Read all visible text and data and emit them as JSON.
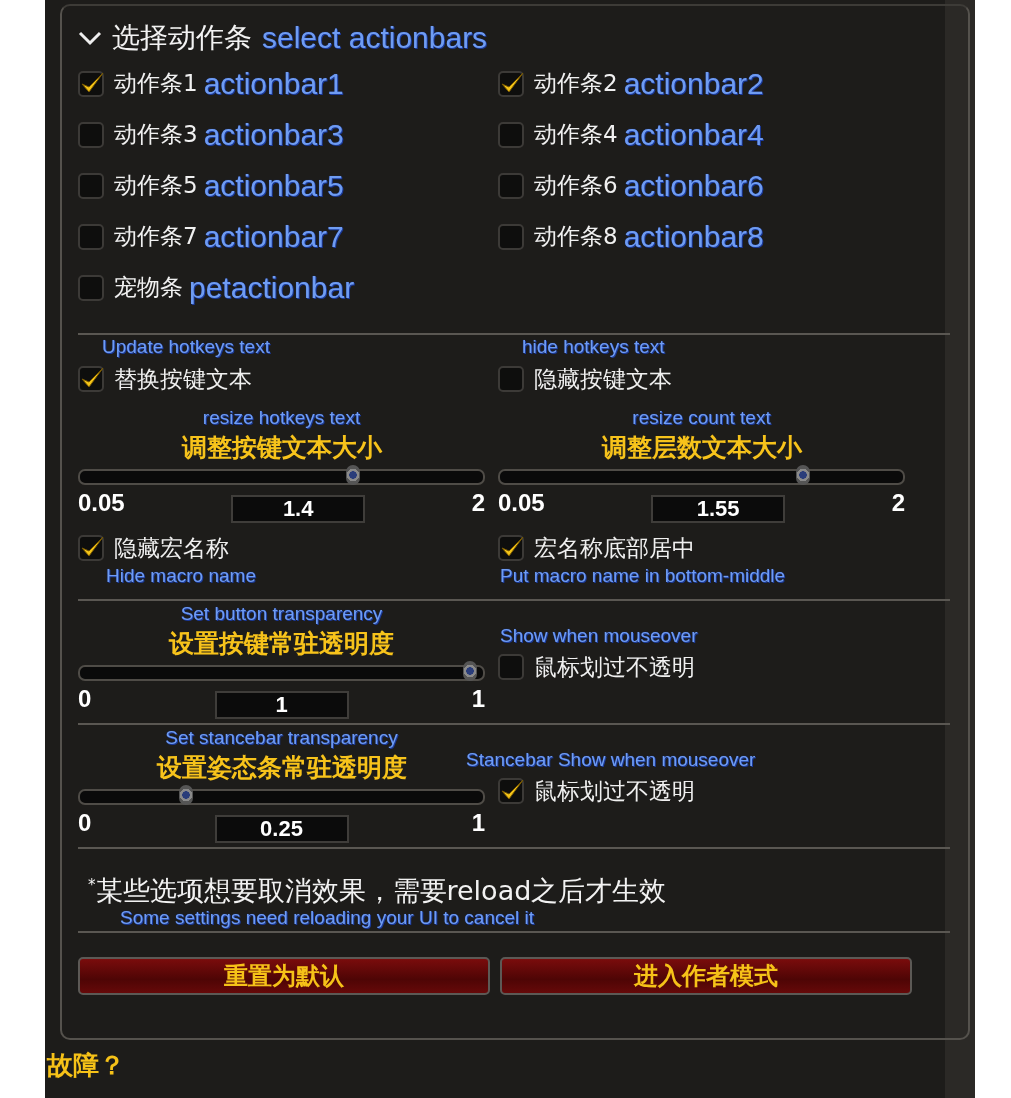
{
  "header": {
    "expanded": true,
    "title": "选择动作条",
    "annotation": "select actionbars"
  },
  "actionbars": [
    {
      "label": "动作条1",
      "annotation": "actionbar1",
      "checked": true
    },
    {
      "label": "动作条2",
      "annotation": "actionbar2",
      "checked": true
    },
    {
      "label": "动作条3",
      "annotation": "actionbar3",
      "checked": false
    },
    {
      "label": "动作条4",
      "annotation": "actionbar4",
      "checked": false
    },
    {
      "label": "动作条5",
      "annotation": "actionbar5",
      "checked": false
    },
    {
      "label": "动作条6",
      "annotation": "actionbar6",
      "checked": false
    },
    {
      "label": "动作条7",
      "annotation": "actionbar7",
      "checked": false
    },
    {
      "label": "动作条8",
      "annotation": "actionbar8",
      "checked": false
    },
    {
      "label": "宠物条",
      "annotation": "petactionbar",
      "checked": false
    }
  ],
  "hotkey_options": [
    {
      "annotation": "Update hotkeys text",
      "label": "替换按键文本",
      "checked": true
    },
    {
      "annotation": "hide hotkeys text",
      "label": "隐藏按键文本",
      "checked": false
    }
  ],
  "sliders": [
    {
      "annotation": "resize hotkeys text",
      "title": "调整按键文本大小",
      "min": "0.05",
      "max": "2",
      "value": "1.4",
      "level": 0.69
    },
    {
      "annotation": "resize count text",
      "title": "调整层数文本大小",
      "min": "0.05",
      "max": "2",
      "value": "1.55",
      "level": 0.77
    }
  ],
  "macro_options": [
    {
      "label": "隐藏宏名称",
      "annotation": "Hide macro name",
      "checked": true
    },
    {
      "label": "宏名称底部居中",
      "annotation": "Put macro name in bottom-middle",
      "checked": true
    }
  ],
  "transparency": [
    {
      "slider": {
        "annotation": "Set button transparency",
        "title": "设置按键常驻透明度",
        "min": "0",
        "max": "1",
        "value": "1",
        "level": 1
      },
      "mouseover": {
        "annotation": "Show when mouseover",
        "label": "鼠标划过不透明",
        "checked": false
      }
    },
    {
      "slider": {
        "annotation": "Set stancebar transparency",
        "title": "设置姿态条常驻透明度",
        "min": "0",
        "max": "1",
        "value": "0.25",
        "level": 0.25
      },
      "mouseover": {
        "annotation": "Stancebar Show when mouseover",
        "label": "鼠标划过不透明",
        "checked": true
      }
    }
  ],
  "note": {
    "text": "$^{*}$某些选项想要取消效果，需要reload之后才生效",
    "annotation": "Some settings need reloading your UI to cancel it"
  },
  "buttons": [
    "重置为默认",
    "进入作者模式"
  ],
  "footer_text": "故障？"
}
